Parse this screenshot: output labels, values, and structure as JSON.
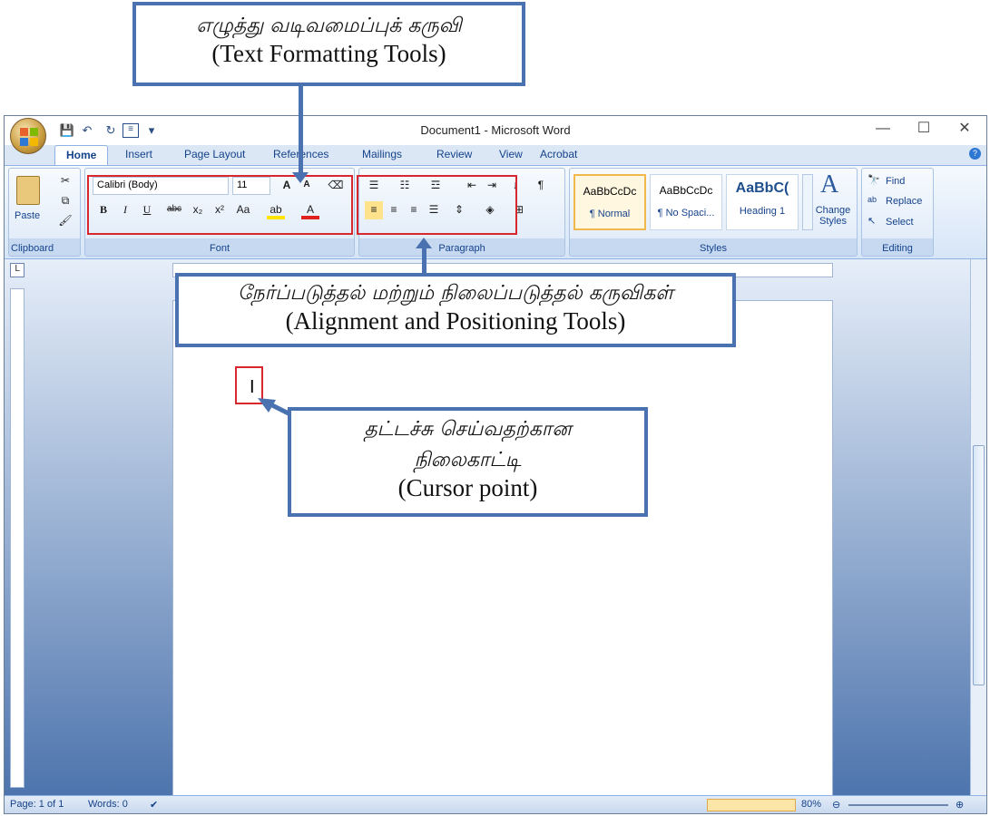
{
  "callouts": {
    "text_formatting": {
      "tamil": "எழுத்து வடிவமைப்புக் கருவி",
      "english": "(Text Formatting Tools)"
    },
    "alignment": {
      "tamil": "நேர்ப்படுத்தல் மற்றும் நிலைப்படுத்தல் கருவிகள்",
      "english": "(Alignment and Positioning Tools)"
    },
    "cursor": {
      "tamil_line1": "தட்டச்சு செய்வதற்கான",
      "tamil_line2": "நிலைகாட்டி",
      "english": "(Cursor point)"
    }
  },
  "window": {
    "title": "Document1 - Microsoft Word",
    "minimize": "—",
    "maximize": "☐",
    "close": "✕"
  },
  "tabs": [
    "Home",
    "Insert",
    "Page Layout",
    "References",
    "Mailings",
    "Review",
    "View",
    "Acrobat"
  ],
  "ribbon": {
    "clipboard": {
      "label": "Clipboard",
      "paste": "Paste"
    },
    "font": {
      "label": "Font",
      "font_name": "Calibri (Body)",
      "font_size": "11"
    },
    "paragraph": {
      "label": "Paragraph"
    },
    "styles": {
      "label": "Styles",
      "items": [
        {
          "sample": "AaBbCcDc",
          "name": "¶ Normal"
        },
        {
          "sample": "AaBbCcDc",
          "name": "¶ No Spaci..."
        },
        {
          "sample": "AaBbC(",
          "name": "Heading 1"
        }
      ],
      "change_styles": "Change Styles"
    },
    "editing": {
      "label": "Editing",
      "find": "Find",
      "replace": "Replace",
      "select": "Select"
    }
  },
  "document": {
    "cursor": "I"
  },
  "status": {
    "page": "Page: 1 of 1",
    "words": "Words: 0",
    "zoom": "80%"
  },
  "colors": {
    "accent": "#4a72b0",
    "highlight": "#d9272e"
  }
}
